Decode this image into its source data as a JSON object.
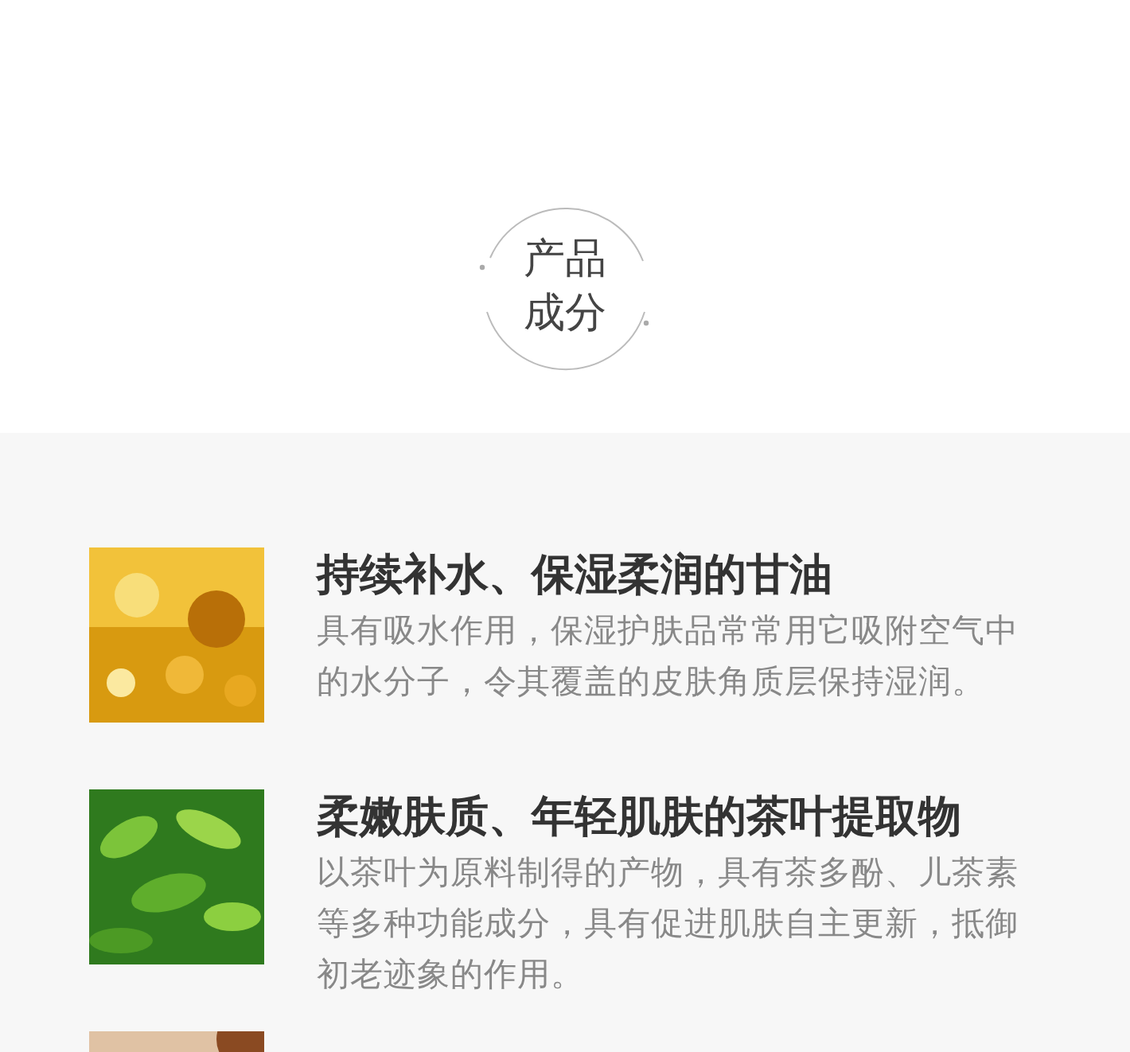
{
  "badge": {
    "lines": [
      "产品",
      "成分"
    ]
  },
  "ingredients": [
    {
      "title": "持续补水、保湿柔润的甘油",
      "description": "具有吸水作用，保湿护肤品常常用它吸附空气中的水分子，令其覆盖的皮肤角质层保持湿润。",
      "kind": "picture"
    },
    {
      "title": "柔嫩肤质、年轻肌肤的茶叶提取物",
      "description": "以茶叶为原料制得的产物，具有茶多酚、儿茶素等多种功能成分，具有促进肌肤自主更新，抵御初老迹象的作用。",
      "kind": "picture"
    },
    {
      "kind": "picture"
    }
  ]
}
